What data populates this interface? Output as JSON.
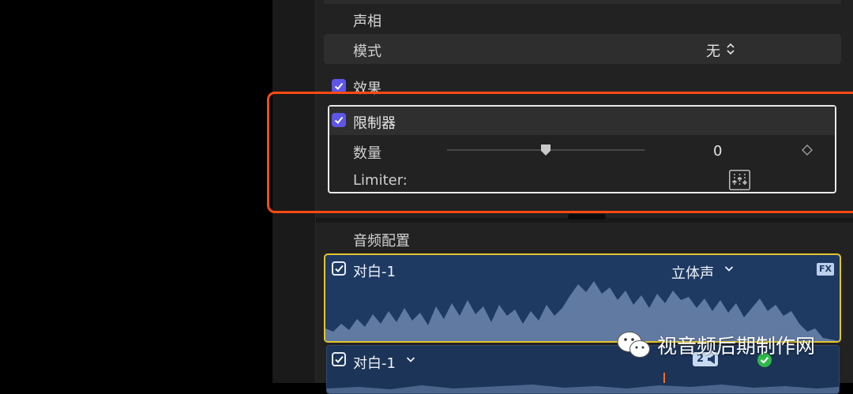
{
  "pan": {
    "section_label": "声相",
    "mode_label": "模式",
    "mode_value": "无"
  },
  "effects": {
    "section_label": "效果",
    "checked": true
  },
  "limiter": {
    "name": "限制器",
    "checked": true,
    "amount_label": "数量",
    "amount_value": "0",
    "amount_slider_fraction": 0.5,
    "limiter_label": "Limiter:"
  },
  "audio_config": {
    "section_label": "音频配置",
    "components": [
      {
        "name": "对白-1",
        "role": "立体声",
        "checked": true,
        "badge": "FX"
      },
      {
        "name": "对白-1",
        "checked": true,
        "channel_badge": "2"
      }
    ]
  },
  "watermark": {
    "text": "视音频后期制作网"
  },
  "colors": {
    "highlight": "#ff4a12",
    "checkbox": "#5d56e6",
    "audio_card": "#1e3a63",
    "audio_selected_border": "#e3c42f"
  }
}
